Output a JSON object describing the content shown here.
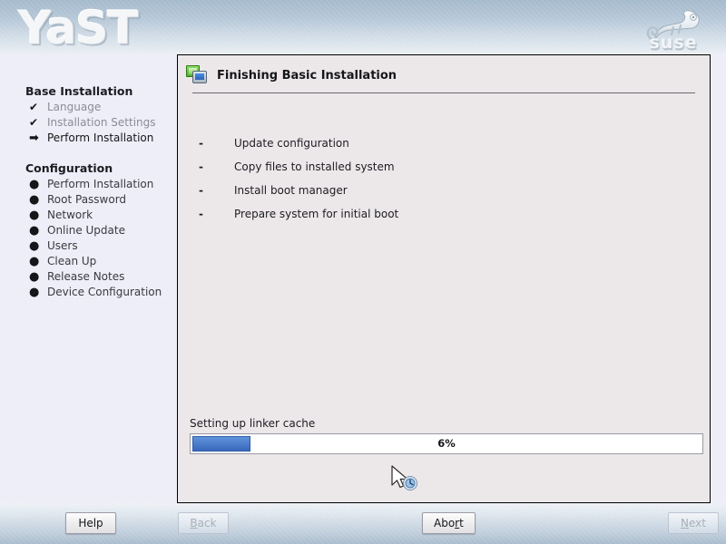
{
  "header": {
    "product_logo": "YaST",
    "brand_logo_text": "suse",
    "brand_icon": "chameleon-icon"
  },
  "sidebar": {
    "sections": [
      {
        "title": "Base Installation",
        "items": [
          {
            "label": "Language",
            "marker": "✔",
            "state": "done"
          },
          {
            "label": "Installation Settings",
            "marker": "✔",
            "state": "done"
          },
          {
            "label": "Perform Installation",
            "marker": "➡",
            "state": "current"
          }
        ]
      },
      {
        "title": "Configuration",
        "items": [
          {
            "label": "Perform Installation",
            "marker": "●",
            "state": "pending"
          },
          {
            "label": "Root Password",
            "marker": "●",
            "state": "pending"
          },
          {
            "label": "Network",
            "marker": "●",
            "state": "pending"
          },
          {
            "label": "Online Update",
            "marker": "●",
            "state": "pending"
          },
          {
            "label": "Users",
            "marker": "●",
            "state": "pending"
          },
          {
            "label": "Clean Up",
            "marker": "●",
            "state": "pending"
          },
          {
            "label": "Release Notes",
            "marker": "●",
            "state": "pending"
          },
          {
            "label": "Device Configuration",
            "marker": "●",
            "state": "pending"
          }
        ]
      }
    ]
  },
  "main": {
    "title": "Finishing Basic Installation",
    "title_icon": "install-screen-icon",
    "tasks": [
      {
        "bullet": "-",
        "label": "Update configuration"
      },
      {
        "bullet": "-",
        "label": "Copy files to installed system"
      },
      {
        "bullet": "-",
        "label": "Install boot manager"
      },
      {
        "bullet": "-",
        "label": "Prepare system for initial boot"
      }
    ],
    "progress": {
      "status_text": "Setting up linker cache",
      "percent_label": "6%",
      "percent_value": 6,
      "fill_color": "#3868bc"
    },
    "cursor_icon": "arrow-busy-cursor"
  },
  "buttons": {
    "help": {
      "label": "Help",
      "mnemonic": "",
      "disabled": false
    },
    "back": {
      "label": "Back",
      "mnemonic": "B",
      "disabled": true
    },
    "abort": {
      "label": "Abort",
      "mnemonic": "r",
      "disabled": false
    },
    "next": {
      "label": "Next",
      "mnemonic": "N",
      "disabled": true
    }
  }
}
